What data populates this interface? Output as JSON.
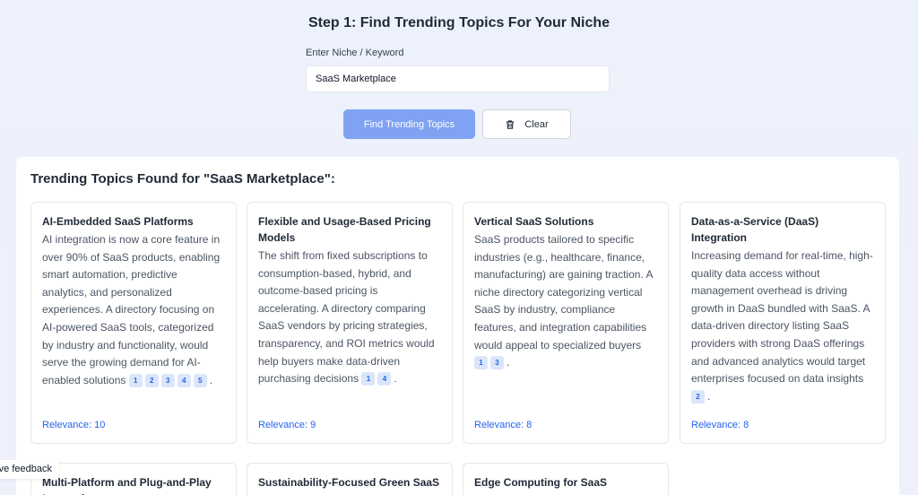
{
  "header": {
    "title": "Step 1: Find Trending Topics For Your Niche"
  },
  "form": {
    "label": "Enter Niche / Keyword",
    "value": "SaaS Marketplace",
    "find_button": "Find Trending Topics",
    "clear_button": "Clear",
    "clear_icon": "trash-icon"
  },
  "results": {
    "title": "Trending Topics Found for \"SaaS Marketplace\":",
    "cards": [
      {
        "title": "AI-Embedded SaaS Platforms",
        "description": "AI integration is now a core feature in over 90% of SaaS products, enabling smart automation, predictive analytics, and personalized experiences. A directory focusing on AI-powered SaaS tools, categorized by industry and functionality, would serve the growing demand for AI-enabled solutions",
        "citations": [
          "1",
          "2",
          "3",
          "4",
          "5"
        ],
        "relevance": "Relevance: 10"
      },
      {
        "title": "Flexible and Usage-Based Pricing Models",
        "description": "The shift from fixed subscriptions to consumption-based, hybrid, and outcome-based pricing is accelerating. A directory comparing SaaS vendors by pricing strategies, transparency, and ROI metrics would help buyers make data-driven purchasing decisions",
        "citations": [
          "1",
          "4"
        ],
        "relevance": "Relevance: 9"
      },
      {
        "title": "Vertical SaaS Solutions",
        "description": "SaaS products tailored to specific industries (e.g., healthcare, finance, manufacturing) are gaining traction. A niche directory categorizing vertical SaaS by industry, compliance features, and integration capabilities would appeal to specialized buyers",
        "citations": [
          "1",
          "3"
        ],
        "relevance": "Relevance: 8"
      },
      {
        "title": "Data-as-a-Service (DaaS) Integration",
        "description": "Increasing demand for real-time, high-quality data access without management overhead is driving growth in DaaS bundled with SaaS. A data-driven directory listing SaaS providers with strong DaaS offerings and advanced analytics would target enterprises focused on data insights",
        "citations": [
          "2"
        ],
        "relevance": "Relevance: 8"
      },
      {
        "title": "Multi-Platform and Plug-and-Play Integration"
      },
      {
        "title": "Sustainability-Focused Green SaaS"
      },
      {
        "title": "Edge Computing for SaaS"
      }
    ]
  },
  "feedback": {
    "label": "Give feedback"
  }
}
